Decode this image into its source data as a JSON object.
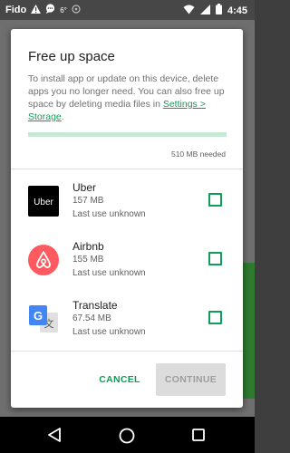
{
  "status_bar": {
    "carrier": "Fido",
    "temperature": "6°",
    "time": "4:45"
  },
  "dialog": {
    "title": "Free up space",
    "description": "To install app or update on this device, delete apps you no longer need. You can also free up space by deleting media files in ",
    "settings_link": "Settings > Storage",
    "description_end": ".",
    "progress_fraction": 0.0,
    "needed_text": "510 MB needed",
    "apps": [
      {
        "name": "Uber",
        "size": "157 MB",
        "last_use": "Last use unknown",
        "checked": false
      },
      {
        "name": "Airbnb",
        "size": "155 MB",
        "last_use": "Last use unknown",
        "checked": false
      },
      {
        "name": "Translate",
        "size": "67.54 MB",
        "last_use": "Last use unknown",
        "checked": false
      }
    ],
    "cancel_label": "CANCEL",
    "continue_label": "CONTINUE"
  },
  "colors": {
    "accent": "#0f9d58",
    "airbnb": "#ff5a5f",
    "translate_blue": "#4285f4"
  },
  "icons": {
    "uber_logo_text": "Uber"
  }
}
